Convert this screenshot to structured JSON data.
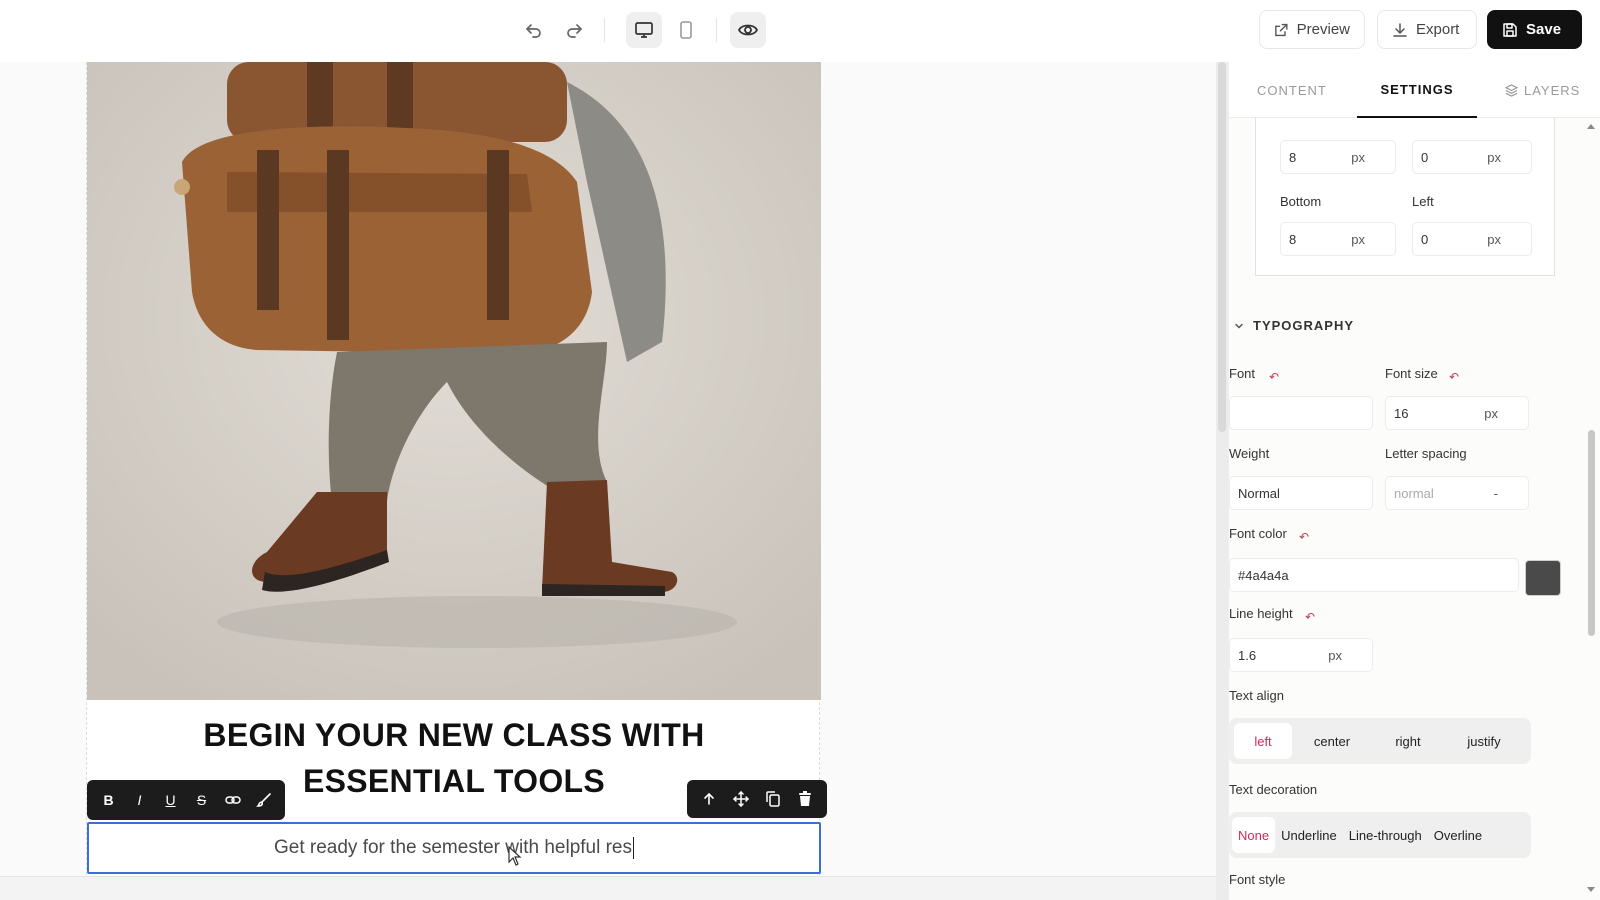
{
  "topbar": {
    "preview_label": "Preview",
    "export_label": "Export",
    "save_label": "Save",
    "icons": [
      "undo-icon",
      "redo-icon",
      "desktop-icon",
      "mobile-icon",
      "eye-icon"
    ]
  },
  "canvas": {
    "headline_line1": "BEGIN YOUR NEW CLASS WITH",
    "headline_line2": "ESSENTIAL TOOLS",
    "body_text": "Get ready for the semester with helpful res",
    "format_toolbar": [
      "B",
      "I",
      "U",
      "S"
    ],
    "body_text_color": "#4a4a4a",
    "selection_color": "#3b6fd8"
  },
  "panel": {
    "tabs": {
      "content": "CONTENT",
      "settings": "SETTINGS",
      "layers": "LAYERS"
    },
    "padding": {
      "top_value": "8",
      "right_value": "0",
      "bottom_label": "Bottom",
      "bottom_value": "8",
      "left_label": "Left",
      "left_value": "0",
      "unit": "px"
    },
    "typography": {
      "title": "TYPOGRAPHY",
      "font_label": "Font",
      "font_value": "",
      "font_size_label": "Font size",
      "font_size_value": "16",
      "weight_label": "Weight",
      "weight_value": "Normal",
      "letter_spacing_label": "Letter spacing",
      "letter_spacing_value": "normal",
      "letter_spacing_suffix": "-",
      "font_color_label": "Font color",
      "font_color_value": "#4a4a4a",
      "line_height_label": "Line height",
      "line_height_value": "1.6",
      "text_align_label": "Text align",
      "text_align_options": [
        "left",
        "center",
        "right",
        "justify"
      ],
      "text_align_selected": "left",
      "text_decoration_label": "Text decoration",
      "text_decoration_options": [
        "None",
        "Underline",
        "Line-through",
        "Overline"
      ],
      "text_decoration_selected": "None",
      "font_style_label": "Font style",
      "accent_color": "#d02a5a"
    }
  }
}
